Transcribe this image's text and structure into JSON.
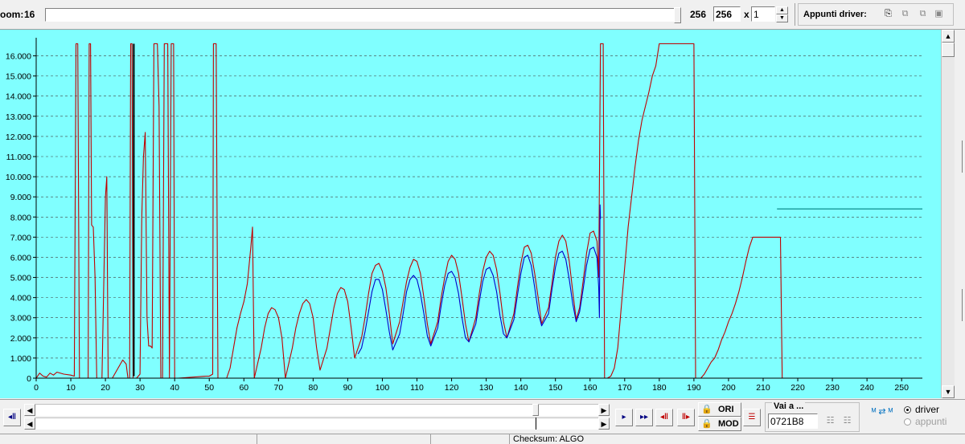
{
  "toolbar": {
    "zoom_label": "oom:",
    "zoom_value": "16",
    "range_max": "256",
    "width_input": "256",
    "multiplier_label": "x",
    "multiplier_input": "1",
    "clipboard_label": "Appunti driver:"
  },
  "bottom": {
    "vai_a_label": "Vai a ...",
    "address_input": "0721B8",
    "ori_label": "ORI",
    "mod_label": "MOD",
    "radio_driver": "driver",
    "radio_appunti": "appunti",
    "status_checksum": "Checksum: ALGO"
  },
  "colors": {
    "plot_background": "#80ffff",
    "series_ori": "#c00000",
    "series_mod": "#0000cc",
    "series_flat": "#008080"
  },
  "chart_data": {
    "type": "line",
    "xlim": [
      0,
      256
    ],
    "ylim": [
      0,
      16500
    ],
    "x_ticks": [
      0,
      10,
      20,
      30,
      40,
      50,
      60,
      70,
      80,
      90,
      100,
      110,
      120,
      130,
      140,
      150,
      160,
      170,
      180,
      190,
      200,
      210,
      220,
      230,
      240,
      250
    ],
    "y_ticks": [
      0,
      1000,
      2000,
      3000,
      4000,
      5000,
      6000,
      7000,
      8000,
      9000,
      10000,
      11000,
      12000,
      13000,
      14000,
      15000,
      16000
    ],
    "y_tick_labels": [
      "0",
      "1.000",
      "2.000",
      "3.000",
      "4.000",
      "5.000",
      "6.000",
      "7.000",
      "8.000",
      "9.000",
      "10.000",
      "11.000",
      "12.000",
      "13.000",
      "14.000",
      "15.000",
      "16.000"
    ],
    "grid": true,
    "series": [
      {
        "color": "#c00000",
        "points": [
          [
            0,
            0
          ],
          [
            1,
            250
          ],
          [
            2,
            100
          ],
          [
            3,
            50
          ],
          [
            4,
            250
          ],
          [
            5,
            150
          ],
          [
            6,
            300
          ],
          [
            8,
            200
          ],
          [
            10,
            150
          ],
          [
            11,
            100
          ],
          [
            11.5,
            16600
          ],
          [
            12,
            16600
          ],
          [
            12.5,
            0
          ],
          [
            15,
            0
          ],
          [
            15.3,
            16600
          ],
          [
            15.7,
            16600
          ],
          [
            16,
            7600
          ],
          [
            16.5,
            7500
          ],
          [
            17,
            5000
          ],
          [
            17.5,
            0
          ],
          [
            19,
            0
          ],
          [
            20,
            9000
          ],
          [
            20.4,
            10000
          ],
          [
            20.8,
            0
          ],
          [
            22,
            0
          ],
          [
            24,
            600
          ],
          [
            25,
            900
          ],
          [
            26,
            700
          ],
          [
            26.5,
            0
          ],
          [
            27,
            0
          ],
          [
            27.3,
            16600
          ],
          [
            27.7,
            16600
          ],
          [
            28,
            0
          ],
          [
            29,
            0
          ],
          [
            30,
            200
          ],
          [
            30.5,
            8000
          ],
          [
            31,
            11000
          ],
          [
            31.5,
            12200
          ],
          [
            32,
            3000
          ],
          [
            32.5,
            1600
          ],
          [
            33,
            1600
          ],
          [
            33.5,
            1500
          ],
          [
            34,
            16600
          ],
          [
            35,
            16600
          ],
          [
            35.5,
            13500
          ],
          [
            36,
            0
          ],
          [
            36.5,
            0
          ],
          [
            37,
            16600
          ],
          [
            38,
            16600
          ],
          [
            38.5,
            0
          ],
          [
            39,
            16600
          ],
          [
            39.7,
            16600
          ],
          [
            40,
            0
          ],
          [
            41,
            0
          ],
          [
            49,
            100
          ],
          [
            50,
            100
          ],
          [
            51,
            200
          ],
          [
            51.2,
            16600
          ],
          [
            52,
            16600
          ],
          [
            52.5,
            0
          ],
          [
            55,
            0
          ],
          [
            56,
            500
          ],
          [
            57,
            1500
          ],
          [
            58,
            2500
          ],
          [
            59,
            3200
          ],
          [
            60,
            3800
          ],
          [
            61,
            4700
          ],
          [
            62,
            6500
          ],
          [
            62.5,
            7500
          ],
          [
            63,
            0
          ],
          [
            65,
            1500
          ],
          [
            66,
            2500
          ],
          [
            67,
            3200
          ],
          [
            68,
            3500
          ],
          [
            69,
            3400
          ],
          [
            70,
            3000
          ],
          [
            71,
            2000
          ],
          [
            72,
            0
          ],
          [
            74,
            1500
          ],
          [
            75,
            2500
          ],
          [
            76,
            3200
          ],
          [
            77,
            3700
          ],
          [
            78,
            3900
          ],
          [
            79,
            3700
          ],
          [
            80,
            3000
          ],
          [
            81,
            1500
          ],
          [
            82,
            400
          ],
          [
            84,
            1500
          ],
          [
            85,
            2500
          ],
          [
            86,
            3500
          ],
          [
            87,
            4200
          ],
          [
            88,
            4500
          ],
          [
            89,
            4400
          ],
          [
            90,
            3800
          ],
          [
            91,
            2500
          ],
          [
            92,
            1000
          ],
          [
            94,
            2000
          ],
          [
            95,
            3000
          ],
          [
            96,
            4200
          ],
          [
            97,
            5200
          ],
          [
            98,
            5600
          ],
          [
            99,
            5700
          ],
          [
            100,
            5300
          ],
          [
            101,
            4500
          ],
          [
            102,
            3200
          ],
          [
            103,
            1700
          ],
          [
            105,
            2800
          ],
          [
            106,
            3800
          ],
          [
            107,
            4800
          ],
          [
            108,
            5500
          ],
          [
            109,
            5900
          ],
          [
            110,
            5800
          ],
          [
            111,
            5200
          ],
          [
            112,
            4000
          ],
          [
            113,
            2700
          ],
          [
            114,
            1700
          ],
          [
            116,
            2800
          ],
          [
            117,
            4000
          ],
          [
            118,
            5000
          ],
          [
            119,
            5800
          ],
          [
            120,
            6100
          ],
          [
            121,
            5900
          ],
          [
            122,
            5200
          ],
          [
            123,
            4000
          ],
          [
            124,
            2700
          ],
          [
            125,
            1800
          ],
          [
            127,
            3000
          ],
          [
            128,
            4200
          ],
          [
            129,
            5300
          ],
          [
            130,
            6000
          ],
          [
            131,
            6300
          ],
          [
            132,
            6100
          ],
          [
            133,
            5400
          ],
          [
            134,
            4200
          ],
          [
            135,
            2800
          ],
          [
            136,
            2000
          ],
          [
            138,
            3200
          ],
          [
            139,
            4500
          ],
          [
            140,
            5700
          ],
          [
            141,
            6500
          ],
          [
            142,
            6600
          ],
          [
            143,
            6200
          ],
          [
            144,
            5200
          ],
          [
            145,
            4000
          ],
          [
            146,
            2700
          ],
          [
            148,
            3500
          ],
          [
            149,
            4700
          ],
          [
            150,
            6000
          ],
          [
            151,
            6800
          ],
          [
            152,
            7100
          ],
          [
            153,
            6800
          ],
          [
            154,
            5800
          ],
          [
            155,
            4300
          ],
          [
            156,
            2900
          ],
          [
            157,
            3500
          ],
          [
            158,
            4800
          ],
          [
            159,
            6200
          ],
          [
            160,
            7200
          ],
          [
            161,
            7300
          ],
          [
            162,
            6800
          ],
          [
            162.5,
            5000
          ],
          [
            163,
            16600
          ],
          [
            163.4,
            16600
          ],
          [
            163.8,
            16600
          ],
          [
            164.2,
            0
          ],
          [
            165,
            0
          ],
          [
            166,
            100
          ],
          [
            167,
            500
          ],
          [
            168,
            1500
          ],
          [
            169,
            3500
          ],
          [
            170,
            5500
          ],
          [
            171,
            7500
          ],
          [
            172,
            9000
          ],
          [
            173,
            10500
          ],
          [
            174,
            11800
          ],
          [
            175,
            12800
          ],
          [
            176,
            13500
          ],
          [
            177,
            14200
          ],
          [
            178,
            15000
          ],
          [
            179,
            15500
          ],
          [
            180,
            16600
          ],
          [
            190,
            16600
          ],
          [
            190.5,
            0
          ],
          [
            192,
            0
          ],
          [
            193,
            200
          ],
          [
            194,
            500
          ],
          [
            195,
            800
          ],
          [
            196,
            1000
          ],
          [
            197,
            1400
          ],
          [
            198,
            1900
          ],
          [
            199,
            2300
          ],
          [
            200,
            2800
          ],
          [
            201,
            3200
          ],
          [
            202,
            3700
          ],
          [
            203,
            4300
          ],
          [
            204,
            5000
          ],
          [
            205,
            5800
          ],
          [
            206,
            6500
          ],
          [
            207,
            7000
          ],
          [
            208,
            7000
          ],
          [
            209,
            7000
          ],
          [
            210,
            7000
          ],
          [
            211,
            7000
          ],
          [
            212,
            7000
          ],
          [
            213,
            7000
          ],
          [
            214,
            7000
          ],
          [
            215,
            7000
          ],
          [
            215.5,
            0
          ],
          [
            230,
            0
          ],
          [
            240,
            0
          ],
          [
            256,
            0
          ]
        ]
      },
      {
        "color": "#0000cc",
        "points": [
          [
            93,
            1200
          ],
          [
            94,
            1500
          ],
          [
            95,
            2300
          ],
          [
            96,
            3300
          ],
          [
            97,
            4300
          ],
          [
            98,
            4900
          ],
          [
            99,
            4900
          ],
          [
            100,
            4400
          ],
          [
            101,
            3400
          ],
          [
            102,
            2300
          ],
          [
            103,
            1400
          ],
          [
            105,
            2200
          ],
          [
            106,
            3200
          ],
          [
            107,
            4300
          ],
          [
            108,
            4900
          ],
          [
            109,
            5100
          ],
          [
            110,
            4900
          ],
          [
            111,
            4200
          ],
          [
            112,
            3200
          ],
          [
            113,
            2100
          ],
          [
            114,
            1600
          ],
          [
            116,
            2500
          ],
          [
            117,
            3600
          ],
          [
            118,
            4600
          ],
          [
            119,
            5200
          ],
          [
            120,
            5300
          ],
          [
            121,
            5000
          ],
          [
            122,
            4200
          ],
          [
            123,
            3000
          ],
          [
            124,
            2000
          ],
          [
            125,
            1800
          ],
          [
            127,
            2700
          ],
          [
            128,
            3800
          ],
          [
            129,
            4800
          ],
          [
            130,
            5400
          ],
          [
            131,
            5500
          ],
          [
            132,
            5100
          ],
          [
            133,
            4300
          ],
          [
            134,
            3100
          ],
          [
            135,
            2200
          ],
          [
            136,
            2000
          ],
          [
            138,
            2900
          ],
          [
            139,
            4100
          ],
          [
            140,
            5200
          ],
          [
            141,
            6000
          ],
          [
            142,
            6100
          ],
          [
            143,
            5600
          ],
          [
            144,
            4500
          ],
          [
            145,
            3300
          ],
          [
            146,
            2600
          ],
          [
            148,
            3200
          ],
          [
            149,
            4400
          ],
          [
            150,
            5500
          ],
          [
            151,
            6200
          ],
          [
            152,
            6300
          ],
          [
            153,
            5900
          ],
          [
            154,
            4900
          ],
          [
            155,
            3700
          ],
          [
            156,
            2800
          ],
          [
            157,
            3300
          ],
          [
            158,
            4400
          ],
          [
            159,
            5600
          ],
          [
            160,
            6400
          ],
          [
            161,
            6500
          ],
          [
            162,
            6000
          ],
          [
            162.5,
            4500
          ],
          [
            162.7,
            3000
          ],
          [
            162.9,
            8600
          ],
          [
            163,
            7900
          ]
        ]
      },
      {
        "color": "#008080",
        "points": [
          [
            214,
            8400
          ],
          [
            256,
            8400
          ]
        ]
      }
    ]
  }
}
